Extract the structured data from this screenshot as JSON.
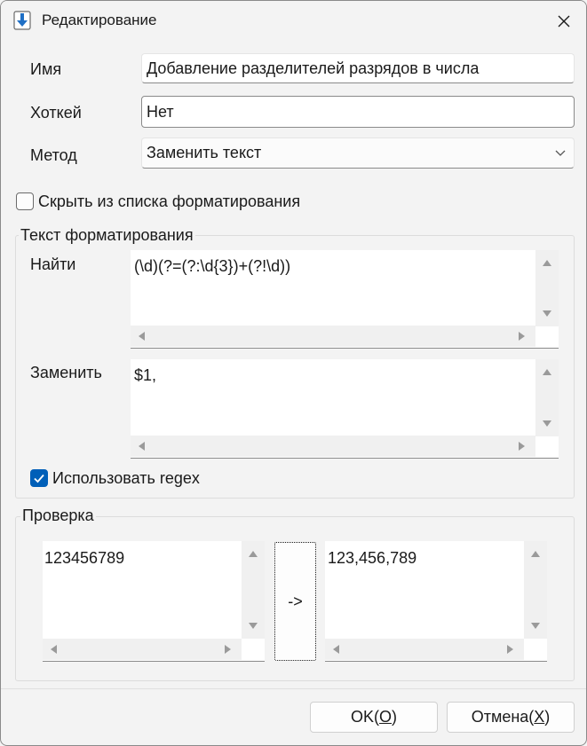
{
  "window": {
    "title": "Редактирование"
  },
  "form": {
    "name_label": "Имя",
    "name_value": "Добавление разделителей разрядов в числа",
    "hotkey_label": "Хоткей",
    "hotkey_value": "Нет",
    "method_label": "Метод",
    "method_value": "Заменить текст",
    "hide_checkbox_label": "Скрыть из списка форматирования",
    "hide_checked": false
  },
  "format_group": {
    "title": "Текст форматирования",
    "find_label": "Найти",
    "find_value": "(\\d)(?=(?:\\d{3})+(?!\\d))",
    "replace_label": "Заменить",
    "replace_value": "$1,",
    "regex_label": "Использовать regex",
    "regex_checked": true
  },
  "test_group": {
    "title": "Проверка",
    "input_value": "123456789",
    "run_label": "->",
    "output_value": "123,456,789"
  },
  "buttons": {
    "ok_text": "OK(",
    "ok_key": "O",
    "ok_end": ")",
    "cancel_text": "Отмена(",
    "cancel_key": "X",
    "cancel_end": ")"
  },
  "colors": {
    "accent": "#005fb8",
    "window_bg": "#f3f3f3",
    "scrollbar": "#f0f0f0"
  },
  "icons": {
    "app": "download-arrow-icon",
    "close": "close-icon",
    "combo": "chevron-down-icon"
  }
}
